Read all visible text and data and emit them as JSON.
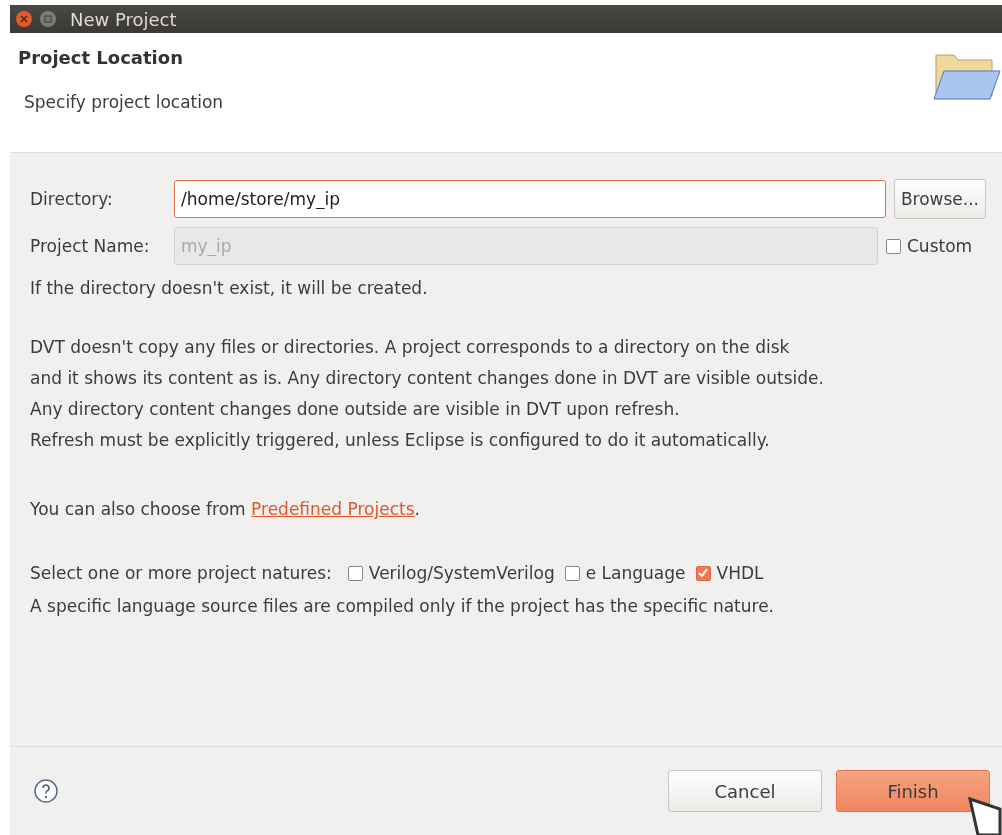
{
  "window": {
    "title": "New Project"
  },
  "header": {
    "title": "Project Location",
    "subtitle": "Specify project location"
  },
  "directory": {
    "label": "Directory:",
    "value": "/home/store/my_ip",
    "focused": true,
    "button": "Browse..."
  },
  "project_name": {
    "label": "Project Name:",
    "placeholder": "my_ip",
    "disabled": true,
    "custom": {
      "label": "Custom",
      "checked": false
    }
  },
  "note": "If the directory doesn't exist, it will be created.",
  "description": [
    "DVT doesn't copy any files or directories. A project corresponds to a directory on the disk",
    "and it shows its content as is. Any directory content changes done in DVT are visible outside.",
    "Any directory content changes done outside are visible in DVT upon refresh.",
    "Refresh must be explicitly triggered, unless Eclipse is configured to do it automatically."
  ],
  "predefined": {
    "text": "You can also choose from ",
    "link": "Predefined Projects",
    "after": "."
  },
  "natures": {
    "label": "Select one or more project natures:",
    "options": [
      {
        "label": "Verilog/SystemVerilog",
        "checked": false
      },
      {
        "label": "e Language",
        "checked": false
      },
      {
        "label": "VHDL",
        "checked": true
      }
    ]
  },
  "natures_note": "A specific language source files are compiled only if the project has the specific nature.",
  "buttons": [
    {
      "label": "Cancel",
      "kind": "secondary"
    },
    {
      "label": "Finish",
      "kind": "primary"
    }
  ]
}
